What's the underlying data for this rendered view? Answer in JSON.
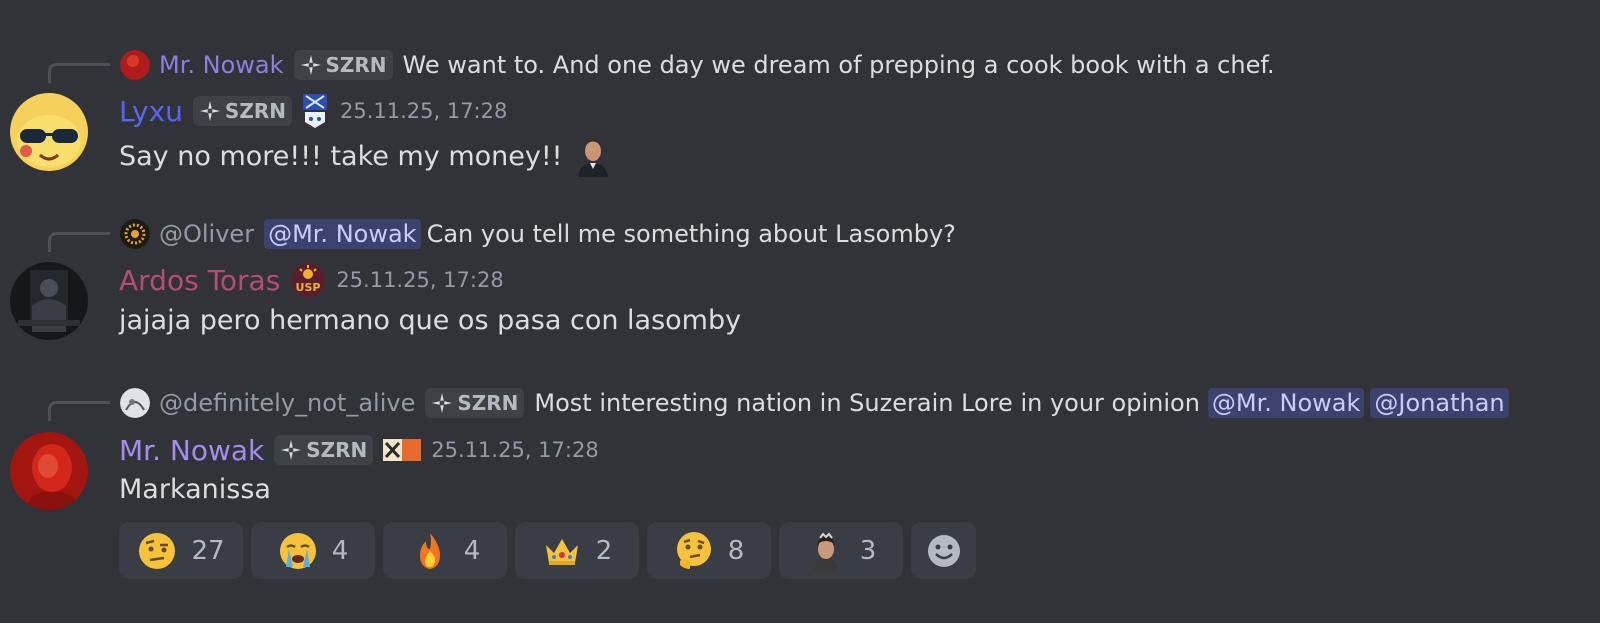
{
  "messages": [
    {
      "reply": {
        "author": "Mr. Nowak",
        "author_color": "#8e7ee0",
        "tag": "SZRN",
        "text": "We want to. And one day we dream of prepping a cook book with a chef."
      },
      "author": "Lyxu",
      "author_color": "#5865f2",
      "tag": "SZRN",
      "timestamp": "25.11.25, 17:28",
      "text": "Say no more!!! take my money!!"
    },
    {
      "reply": {
        "author": "@Oliver",
        "author_color": "#949ba4",
        "mention": "@Mr. Nowak",
        "text": "Can you tell me something about Lasomby?"
      },
      "author": "Ardos Toras",
      "author_color": "#b64d78",
      "badge": "USP",
      "timestamp": "25.11.25, 17:28",
      "text": "jajaja pero hermano que os pasa con lasomby"
    },
    {
      "reply": {
        "author": "@definitely_not_alive",
        "author_color": "#949ba4",
        "tag": "SZRN",
        "text": "Most interesting nation in Suzerain Lore in your opinion",
        "mentions": [
          "@Mr. Nowak",
          "@Jonathan"
        ]
      },
      "author": "Mr. Nowak",
      "author_color": "#a48cf0",
      "tag": "SZRN",
      "timestamp": "25.11.25, 17:28",
      "text": "Markanissa"
    }
  ],
  "reactions": [
    {
      "emoji": "raised-eyebrow-face",
      "count": "27"
    },
    {
      "emoji": "crying-face",
      "count": "4"
    },
    {
      "emoji": "fire",
      "count": "4"
    },
    {
      "emoji": "crown",
      "count": "2"
    },
    {
      "emoji": "thinking-face",
      "count": "8"
    },
    {
      "emoji": "portrait-custom-emoji",
      "count": "3"
    }
  ]
}
